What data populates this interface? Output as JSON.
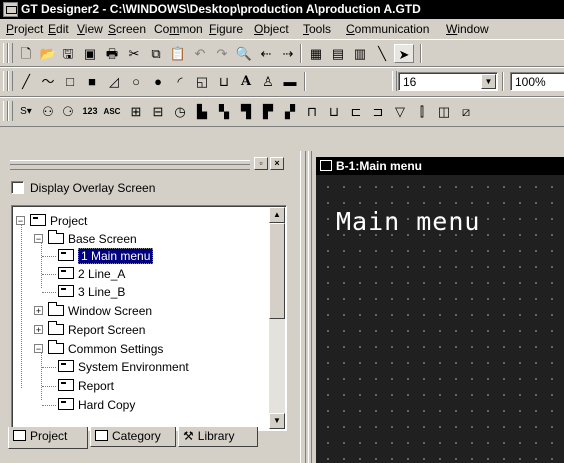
{
  "window": {
    "title": "GT Designer2 - C:\\WINDOWS\\Desktop\\production A\\production A.GTD"
  },
  "menubar": {
    "items": [
      {
        "label": "Project",
        "mnemonic": "P"
      },
      {
        "label": "Edit",
        "mnemonic": "E"
      },
      {
        "label": "View",
        "mnemonic": "V"
      },
      {
        "label": "Screen",
        "mnemonic": "S"
      },
      {
        "label": "Common",
        "mnemonic": "m"
      },
      {
        "label": "Figure",
        "mnemonic": "F"
      },
      {
        "label": "Object",
        "mnemonic": "O"
      },
      {
        "label": "Tools",
        "mnemonic": "T"
      },
      {
        "label": "Communication",
        "mnemonic": "C"
      },
      {
        "label": "Window",
        "mnemonic": "W"
      }
    ]
  },
  "toolbar_figure": {
    "font_size_value": "16",
    "zoom_value": "100%",
    "text_tool": "A"
  },
  "toolbar_object": {
    "numeric_label": "123",
    "ascii_label": "ASC"
  },
  "left_panel": {
    "overlay_checkbox_label": "Display Overlay Screen",
    "overlay_checked": false,
    "tree": {
      "root": "Project",
      "base_screen": "Base Screen",
      "screens": [
        "1 Main menu",
        "2 Line_A",
        "3 Line_B"
      ],
      "window_screen": "Window Screen",
      "report_screen": "Report Screen",
      "common_settings": "Common Settings",
      "common_items": [
        "System Environment",
        "Report",
        "Hard Copy"
      ]
    },
    "tabs": [
      "Project",
      "Category",
      "Library"
    ]
  },
  "editor": {
    "title": "B-1:Main menu",
    "canvas_text": "Main menu"
  },
  "colors": {
    "titlebar_bg": "#000000",
    "face": "#d4d0c8",
    "selection": "#000080",
    "canvas_bg": "#202020"
  }
}
